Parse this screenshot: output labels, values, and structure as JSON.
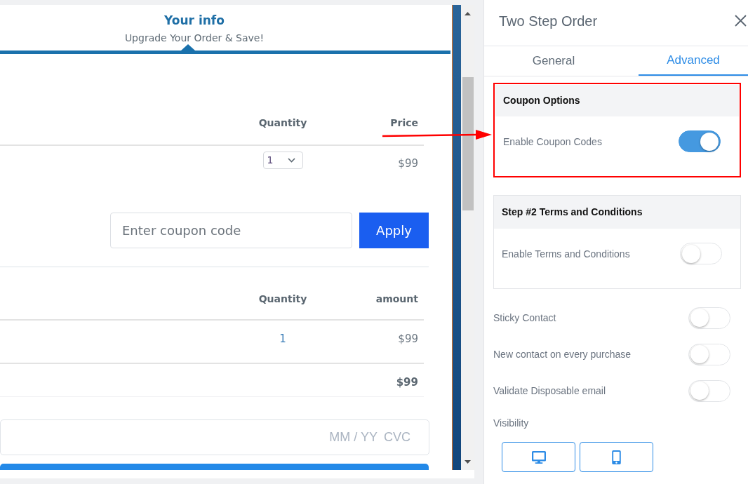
{
  "checkout": {
    "step": {
      "title": "Your info",
      "subtitle": "Upgrade Your Order & Save!"
    },
    "products": {
      "columns": [
        "Quantity",
        "Price"
      ],
      "rows": [
        {
          "quantity": "1",
          "price": "$99"
        }
      ]
    },
    "coupon": {
      "placeholder": "Enter coupon code",
      "button": "Apply"
    },
    "summary": {
      "columns": [
        "Quantity",
        "amount"
      ],
      "rows": [
        {
          "quantity": "1",
          "amount": "$99"
        }
      ],
      "total": "$99"
    },
    "card_field": {
      "expiry_placeholder": "MM / YY",
      "cvc_placeholder": "CVC"
    }
  },
  "panel": {
    "title": "Two Step Order",
    "tabs": [
      {
        "label": "General",
        "selected": false
      },
      {
        "label": "Advanced",
        "selected": true
      }
    ],
    "sections": [
      {
        "title": "Coupon Options",
        "highlighted": true,
        "settings": [
          {
            "label": "Enable Coupon Codes",
            "on": true
          }
        ]
      },
      {
        "title": "Step #2 Terms and Conditions",
        "highlighted": false,
        "settings": [
          {
            "label": "Enable Terms and Conditions",
            "on": false
          }
        ]
      }
    ],
    "settings": [
      {
        "label": "Sticky Contact",
        "on": false
      },
      {
        "label": "New contact on every purchase",
        "on": false
      },
      {
        "label": "Validate Disposable email",
        "on": false
      }
    ],
    "visibility": {
      "label": "Visibility",
      "devices": [
        {
          "kind": "desktop"
        },
        {
          "kind": "mobile"
        }
      ]
    }
  }
}
